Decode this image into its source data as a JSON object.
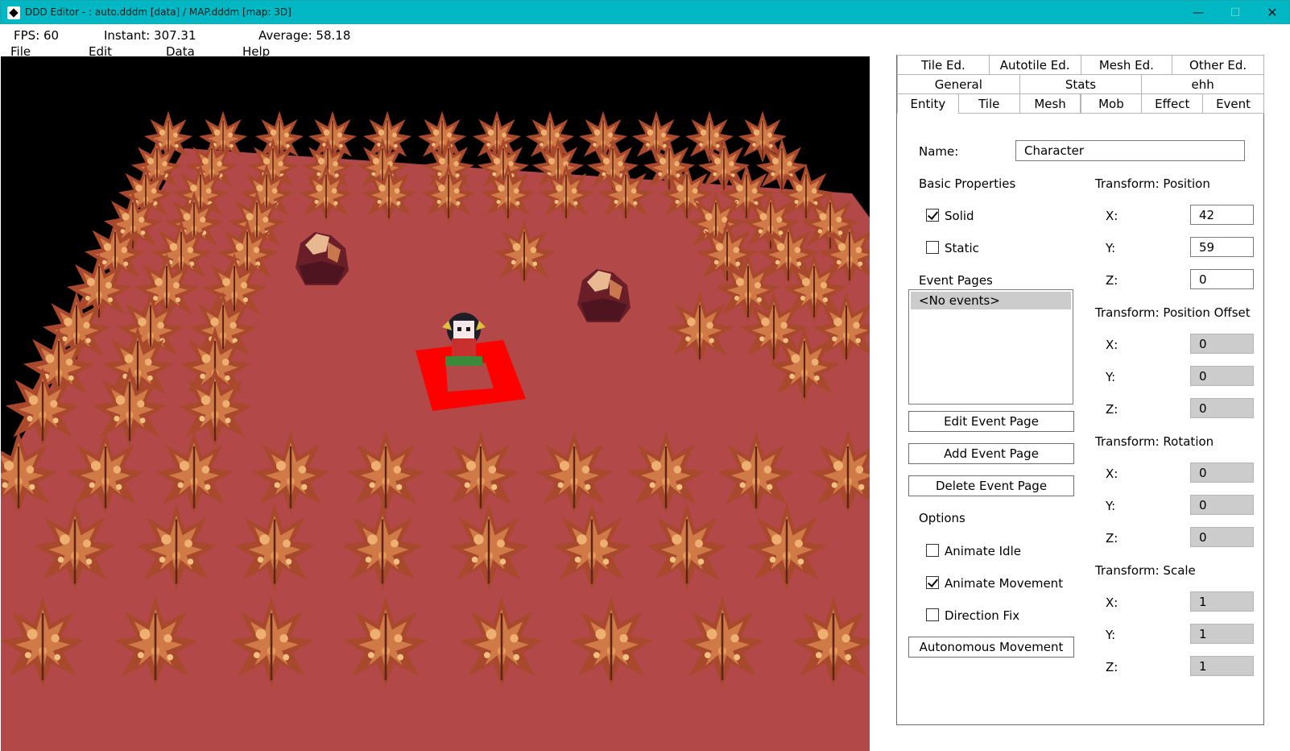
{
  "window": {
    "title": "DDD Editor - : auto.dddm [data] / MAP.dddm [map: 3D]",
    "min_glyph": "—",
    "max_glyph": "☐",
    "close_glyph": "✕"
  },
  "stats": {
    "fps": "FPS: 60",
    "instant": "Instant: 307.31",
    "average": "Average: 58.18"
  },
  "menu": {
    "file": "File",
    "edit": "Edit",
    "data": "Data",
    "help": "Help"
  },
  "tabs": {
    "row1": [
      "Tile Ed.",
      "Autotile Ed.",
      "Mesh Ed.",
      "Other Ed."
    ],
    "row2": [
      "General",
      "Stats",
      "ehh"
    ],
    "row3": [
      "Entity",
      "Tile",
      "Mesh",
      "Mob",
      "Effect",
      "Event"
    ],
    "selected": "Entity"
  },
  "entity": {
    "name_label": "Name:",
    "name_value": "Character",
    "basic_properties": "Basic Properties",
    "solid": {
      "label": "Solid",
      "checked": true
    },
    "static": {
      "label": "Static",
      "checked": false
    },
    "event_pages_label": "Event Pages",
    "event_pages": [
      "<No events>"
    ],
    "edit_event_page": "Edit Event Page",
    "add_event_page": "Add Event Page",
    "delete_event_page": "Delete Event Page",
    "options_label": "Options",
    "animate_idle": {
      "label": "Animate Idle",
      "checked": false
    },
    "animate_movement": {
      "label": "Animate Movement",
      "checked": true
    },
    "direction_fix": {
      "label": "Direction Fix",
      "checked": false
    },
    "autonomous_movement": "Autonomous Movement"
  },
  "transform": {
    "axis_x": "X:",
    "axis_y": "Y:",
    "axis_z": "Z:",
    "position": {
      "label": "Transform: Position",
      "x": "42",
      "y": "59",
      "z": "0"
    },
    "offset": {
      "label": "Transform: Position Offset",
      "x": "0",
      "y": "0",
      "z": "0"
    },
    "rotation": {
      "label": "Transform: Rotation",
      "x": "0",
      "y": "0",
      "z": "0"
    },
    "scale": {
      "label": "Transform: Scale",
      "x": "1",
      "y": "1",
      "z": "1"
    }
  },
  "colors": {
    "titlebar": "#00b8c4",
    "ground": "#b34848",
    "selection": "#ff0000",
    "bush": "#a8482c",
    "bush_light": "#e8a060",
    "rock": "#6a1e28"
  }
}
